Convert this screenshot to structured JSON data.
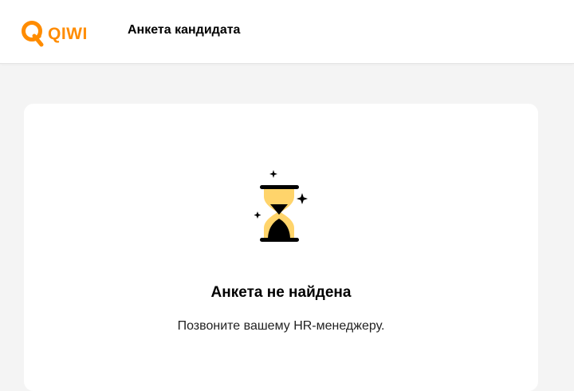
{
  "header": {
    "logo_text": "QIWI",
    "title": "Анкета кандидата"
  },
  "empty_state": {
    "icon": "hourglass-icon",
    "title": "Анкета не найдена",
    "message": "Позвоните вашему HR-менеджеру."
  },
  "colors": {
    "brand": "#FF8C00",
    "sand": "#FFD46B",
    "background": "#F4F4F4",
    "card": "#FFFFFF"
  }
}
